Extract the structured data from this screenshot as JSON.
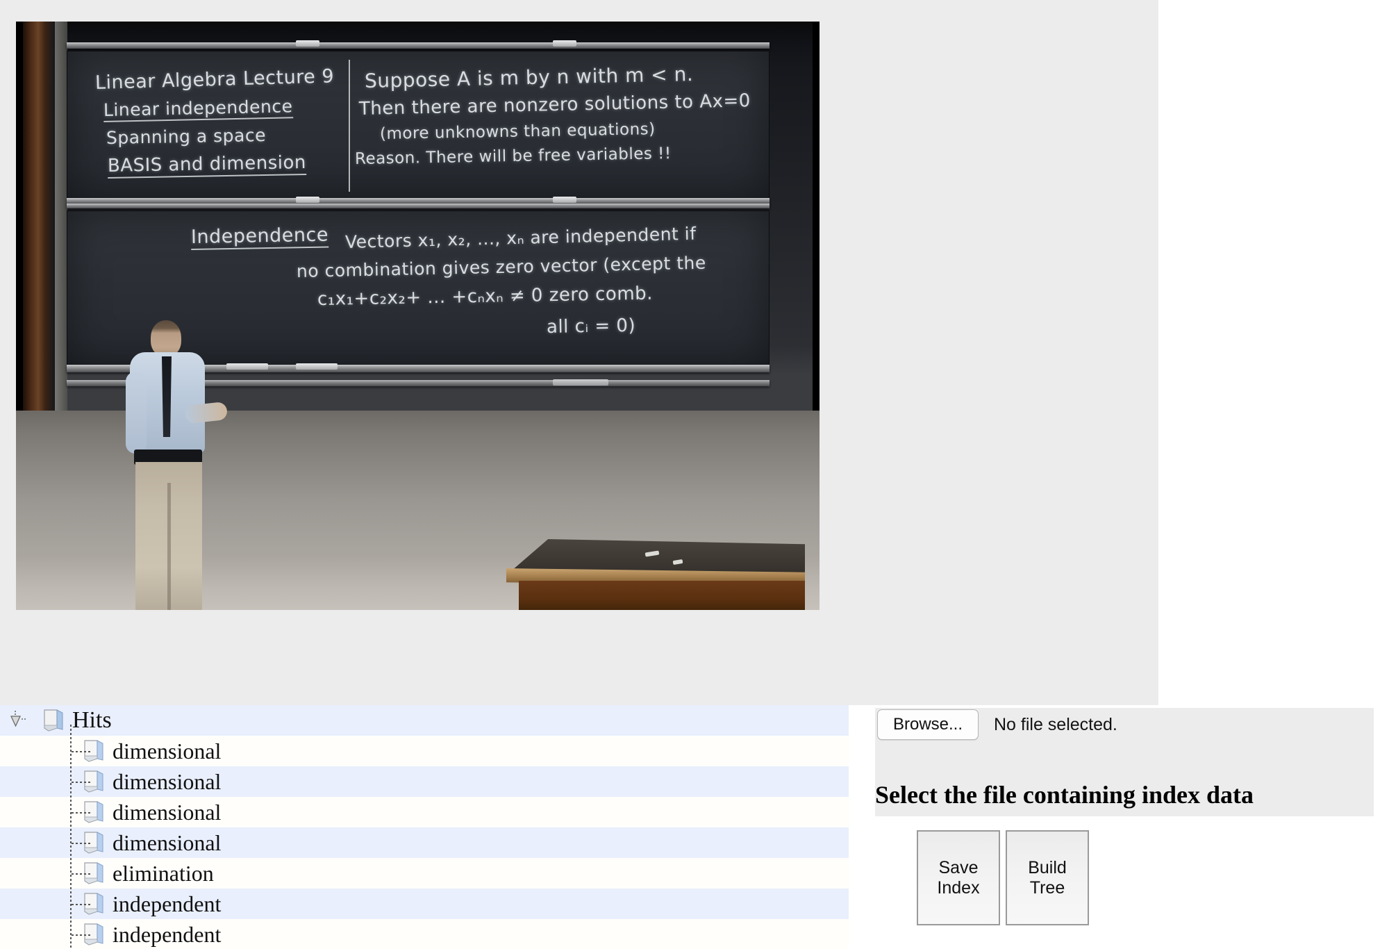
{
  "video": {
    "alt": "MIT linear algebra lecture video still",
    "board_top_left": [
      "Linear Algebra Lecture 9",
      "Linear independence",
      "Spanning a space",
      "BASIS and dimension"
    ],
    "board_top_right": [
      "Suppose A is m by n  with m < n.",
      "Then there are nonzero solutions to Ax=0",
      "(more unknowns than equations)",
      "Reason. There will be free variables !!"
    ],
    "board_bottom": {
      "heading": "Independence",
      "lines": [
        "Vectors x₁, x₂, ..., xₙ are independent if",
        "no combination gives zero vector (except the",
        "c₁x₁+c₂x₂+ ... +cₙxₙ ≠ 0    zero comb.",
        "all cᵢ = 0)"
      ]
    }
  },
  "tree": {
    "root": {
      "label": "Hits",
      "expanded": true
    },
    "items": [
      {
        "label": "dimensional"
      },
      {
        "label": "dimensional"
      },
      {
        "label": "dimensional"
      },
      {
        "label": "dimensional"
      },
      {
        "label": "elimination"
      },
      {
        "label": "independent"
      },
      {
        "label": "independent"
      }
    ]
  },
  "form": {
    "browse_label": "Browse...",
    "file_status": "No file selected.",
    "heading": "Select the file containing index data",
    "buttons": [
      {
        "label": "Save\nIndex",
        "line1": "Save",
        "line2": "Index"
      },
      {
        "label": "Build\nTree",
        "line1": "Build",
        "line2": "Tree"
      }
    ]
  },
  "colors": {
    "panel_gray": "#ececec",
    "row_highlight": "#e9effc",
    "chalk": "#e8ecef",
    "button_border": "#9a9a9a"
  }
}
